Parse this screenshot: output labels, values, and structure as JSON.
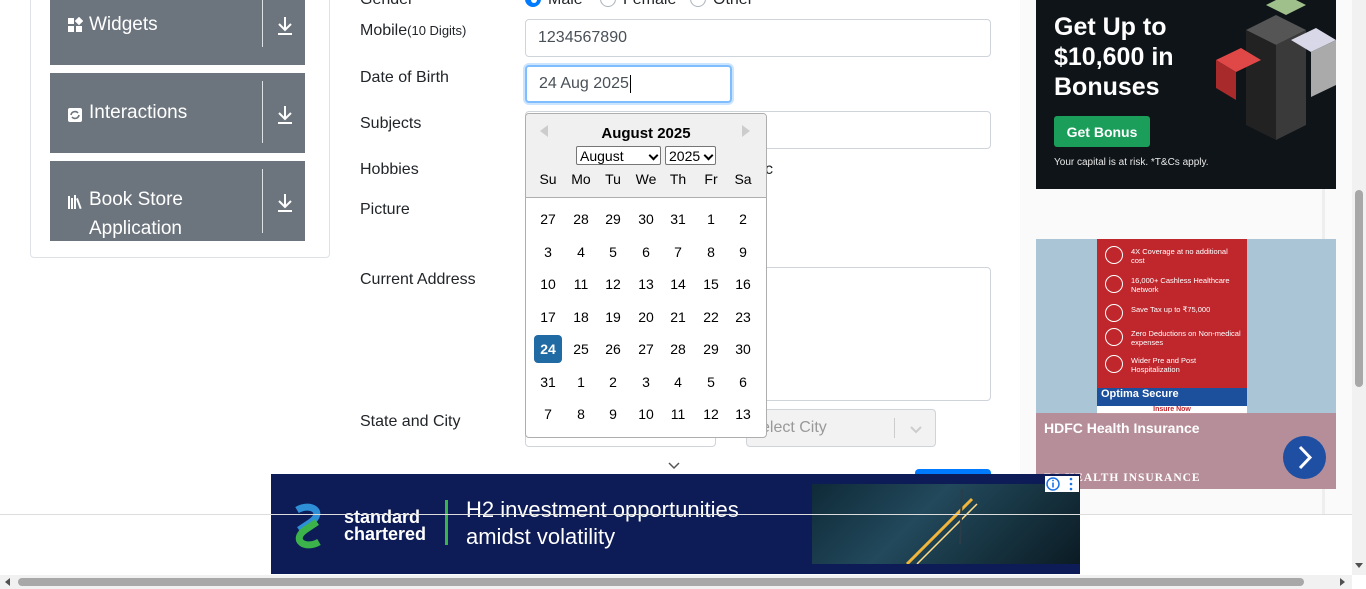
{
  "sidebar": {
    "groups": [
      {
        "label": "Widgets",
        "icon": "widgets-icon"
      },
      {
        "label": "Interactions",
        "icon": "interactions-icon"
      },
      {
        "label": "Book Store",
        "label2": "Application",
        "icon": "book-store-icon"
      }
    ]
  },
  "form": {
    "gender_label": "Gender",
    "gender_options": [
      "Male",
      "Female",
      "Other"
    ],
    "mobile_label": "Mobile",
    "mobile_hint": "(10 Digits)",
    "mobile_value": "1234567890",
    "dob_label": "Date of Birth",
    "dob_value": "24 Aug 2025",
    "subjects_label": "Subjects",
    "hobbies_label": "Hobbies",
    "hobbies_partial": "c",
    "picture_label": "Picture",
    "address_label": "Current Address",
    "state_city_label": "State and City",
    "city_placeholder": "elect City"
  },
  "datepicker": {
    "title": "August 2025",
    "month_select": "August",
    "year_select": "2025",
    "day_names": [
      "Su",
      "Mo",
      "Tu",
      "We",
      "Th",
      "Fr",
      "Sa"
    ],
    "weeks": [
      [
        "27",
        "28",
        "29",
        "30",
        "31",
        "1",
        "2"
      ],
      [
        "3",
        "4",
        "5",
        "6",
        "7",
        "8",
        "9"
      ],
      [
        "10",
        "11",
        "12",
        "13",
        "14",
        "15",
        "16"
      ],
      [
        "17",
        "18",
        "19",
        "20",
        "21",
        "22",
        "23"
      ],
      [
        "24",
        "25",
        "26",
        "27",
        "28",
        "29",
        "30"
      ],
      [
        "31",
        "1",
        "2",
        "3",
        "4",
        "5",
        "6"
      ],
      [
        "7",
        "8",
        "9",
        "10",
        "11",
        "12",
        "13"
      ]
    ],
    "selected": "24"
  },
  "ads": {
    "top_right": {
      "headline": "Get Up to $10,600 in Bonuses",
      "button": "Get Bonus",
      "note": "Your capital is at risk. *T&Cs apply."
    },
    "mid_right": {
      "rows": [
        "4X Coverage at no additional cost",
        "16,000+ Cashless Healthcare Network",
        "Save Tax up to ₹75,000",
        "Zero Deductions on Non-medical expenses",
        "Wider Pre and Post Hospitalization"
      ],
      "brand_bar": "Optima Secure",
      "cta": "Insure Now",
      "title": "HDFC Health Insurance",
      "subtitle": "FC HEALTH INSURANCE"
    },
    "bottom": {
      "logo_line1": "standard",
      "logo_line2": "chartered",
      "headline_line1": "H2 investment opportunities",
      "headline_line2": "amidst volatility"
    }
  },
  "colors": {
    "sidebar_group": "#6c757d",
    "accent": "#007bff",
    "datepicker_selected": "#216ba5"
  }
}
